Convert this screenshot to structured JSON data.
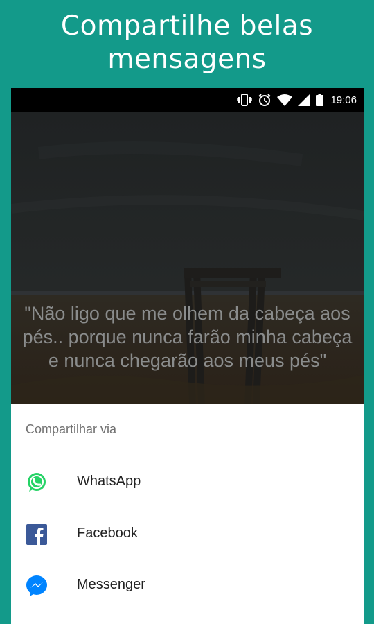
{
  "promo": {
    "title_line1": "Compartilhe belas",
    "title_line2": "mensagens"
  },
  "statusbar": {
    "time": "19:06",
    "icons": [
      "vibrate-icon",
      "alarm-icon",
      "wifi-icon",
      "signal-icon",
      "battery-icon"
    ]
  },
  "quote": {
    "text": "\"Não ligo que me olhem da cabeça aos pés.. porque nunca farão minha cabeça e nunca chegarão aos meus pés\""
  },
  "share_sheet": {
    "title": "Compartilhar via",
    "items": [
      {
        "label": "WhatsApp",
        "icon": "whatsapp-icon"
      },
      {
        "label": "Facebook",
        "icon": "facebook-icon"
      },
      {
        "label": "Messenger",
        "icon": "messenger-icon"
      }
    ]
  },
  "colors": {
    "background": "#139a8a",
    "whatsapp": "#25d366",
    "facebook": "#3b5998",
    "messenger": "#0084ff"
  }
}
